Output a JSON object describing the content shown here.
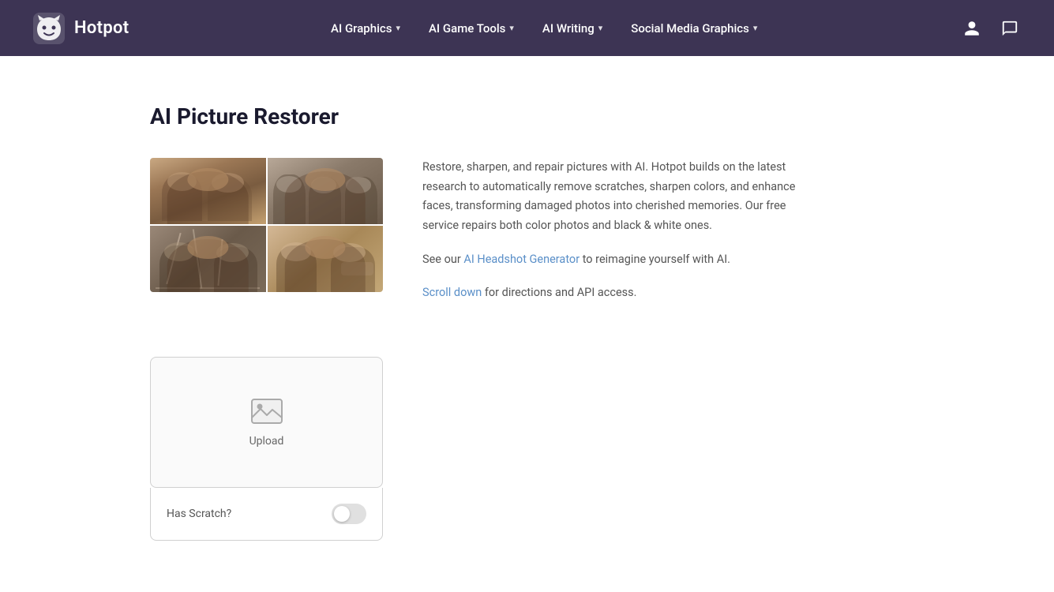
{
  "brand": {
    "logo_text": "Hotpot",
    "logo_icon": "hotpot-face"
  },
  "navbar": {
    "items": [
      {
        "id": "ai-graphics",
        "label": "AI Graphics",
        "has_chevron": true
      },
      {
        "id": "ai-game-tools",
        "label": "AI Game Tools",
        "has_chevron": true
      },
      {
        "id": "ai-writing",
        "label": "AI Writing",
        "has_chevron": true
      },
      {
        "id": "social-media-graphics",
        "label": "Social Media Graphics",
        "has_chevron": true
      }
    ],
    "user_icon": "user",
    "chat_icon": "chat"
  },
  "page": {
    "title": "AI Picture Restorer",
    "description_p1": "Restore, sharpen, and repair pictures with AI. Hotpot builds on the latest research to automatically remove scratches, sharpen colors, and enhance faces, transforming damaged photos into cherished memories. Our free service repairs both color photos and black & white ones.",
    "description_p2_prefix": "See our ",
    "description_link1_text": "AI Headshot Generator",
    "description_p2_suffix": " to reimagine yourself with AI.",
    "description_p3_link": "Scroll down",
    "description_p3_suffix": " for directions and API access.",
    "upload_label": "Upload",
    "option_label": "Has Scratch?",
    "toggle_state": false
  },
  "colors": {
    "navbar_bg": "#3d3454",
    "link_color": "#5a8fc8",
    "title_color": "#1a1a2e"
  }
}
